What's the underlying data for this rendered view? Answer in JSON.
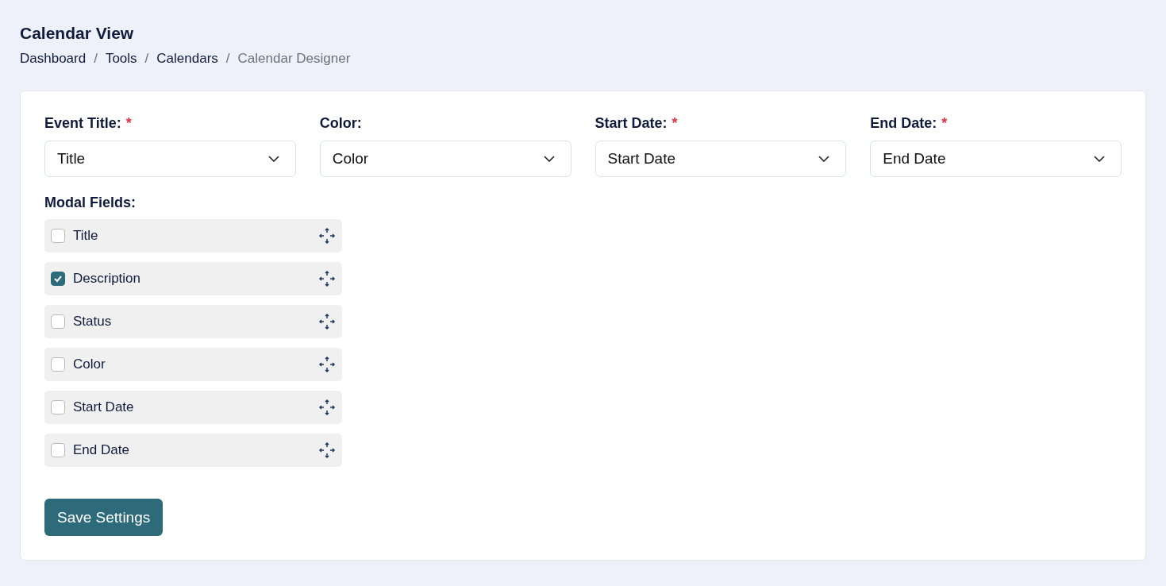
{
  "page": {
    "title": "Calendar View"
  },
  "breadcrumb": [
    {
      "label": "Dashboard",
      "current": false
    },
    {
      "label": "Tools",
      "current": false
    },
    {
      "label": "Calendars",
      "current": false
    },
    {
      "label": "Calendar Designer",
      "current": true
    }
  ],
  "breadcrumb_separator": "/",
  "mapping_fields": [
    {
      "label": "Event Title:",
      "required_mark": "*",
      "value": "Title"
    },
    {
      "label": "Color:",
      "value": "Color"
    },
    {
      "label": "Start Date:",
      "required_mark": "*",
      "value": "Start Date"
    },
    {
      "label": "End Date:",
      "required_mark": "*",
      "value": "End Date"
    }
  ],
  "modal_fields": {
    "label": "Modal Fields:",
    "items": [
      {
        "label": "Title",
        "checked": false
      },
      {
        "label": "Description",
        "checked": true
      },
      {
        "label": "Status",
        "checked": false
      },
      {
        "label": "Color",
        "checked": false
      },
      {
        "label": "Start Date",
        "checked": false
      },
      {
        "label": "End Date",
        "checked": false
      }
    ]
  },
  "save_button": "Save Settings"
}
